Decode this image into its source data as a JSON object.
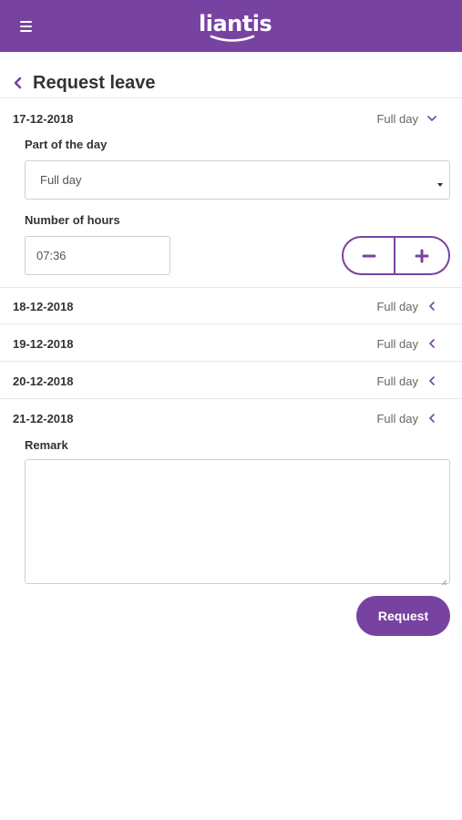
{
  "app": {
    "logo_text": "liantis",
    "brand_color": "#7843a0",
    "menu_icon": "hamburger-icon"
  },
  "page": {
    "title": "Request leave",
    "back_icon": "chevron-left-icon"
  },
  "days": [
    {
      "date": "17-12-2018",
      "part": "Full day",
      "expanded": true
    },
    {
      "date": "18-12-2018",
      "part": "Full day",
      "expanded": false
    },
    {
      "date": "19-12-2018",
      "part": "Full day",
      "expanded": false
    },
    {
      "date": "20-12-2018",
      "part": "Full day",
      "expanded": false
    },
    {
      "date": "21-12-2018",
      "part": "Full day",
      "expanded": false
    }
  ],
  "detail": {
    "part_label": "Part of the day",
    "part_selected": "Full day",
    "hours_label": "Number of hours",
    "hours_value": "07:36",
    "minus_icon": "minus-icon",
    "plus_icon": "plus-icon"
  },
  "remark": {
    "label": "Remark",
    "value": ""
  },
  "actions": {
    "request_label": "Request"
  }
}
